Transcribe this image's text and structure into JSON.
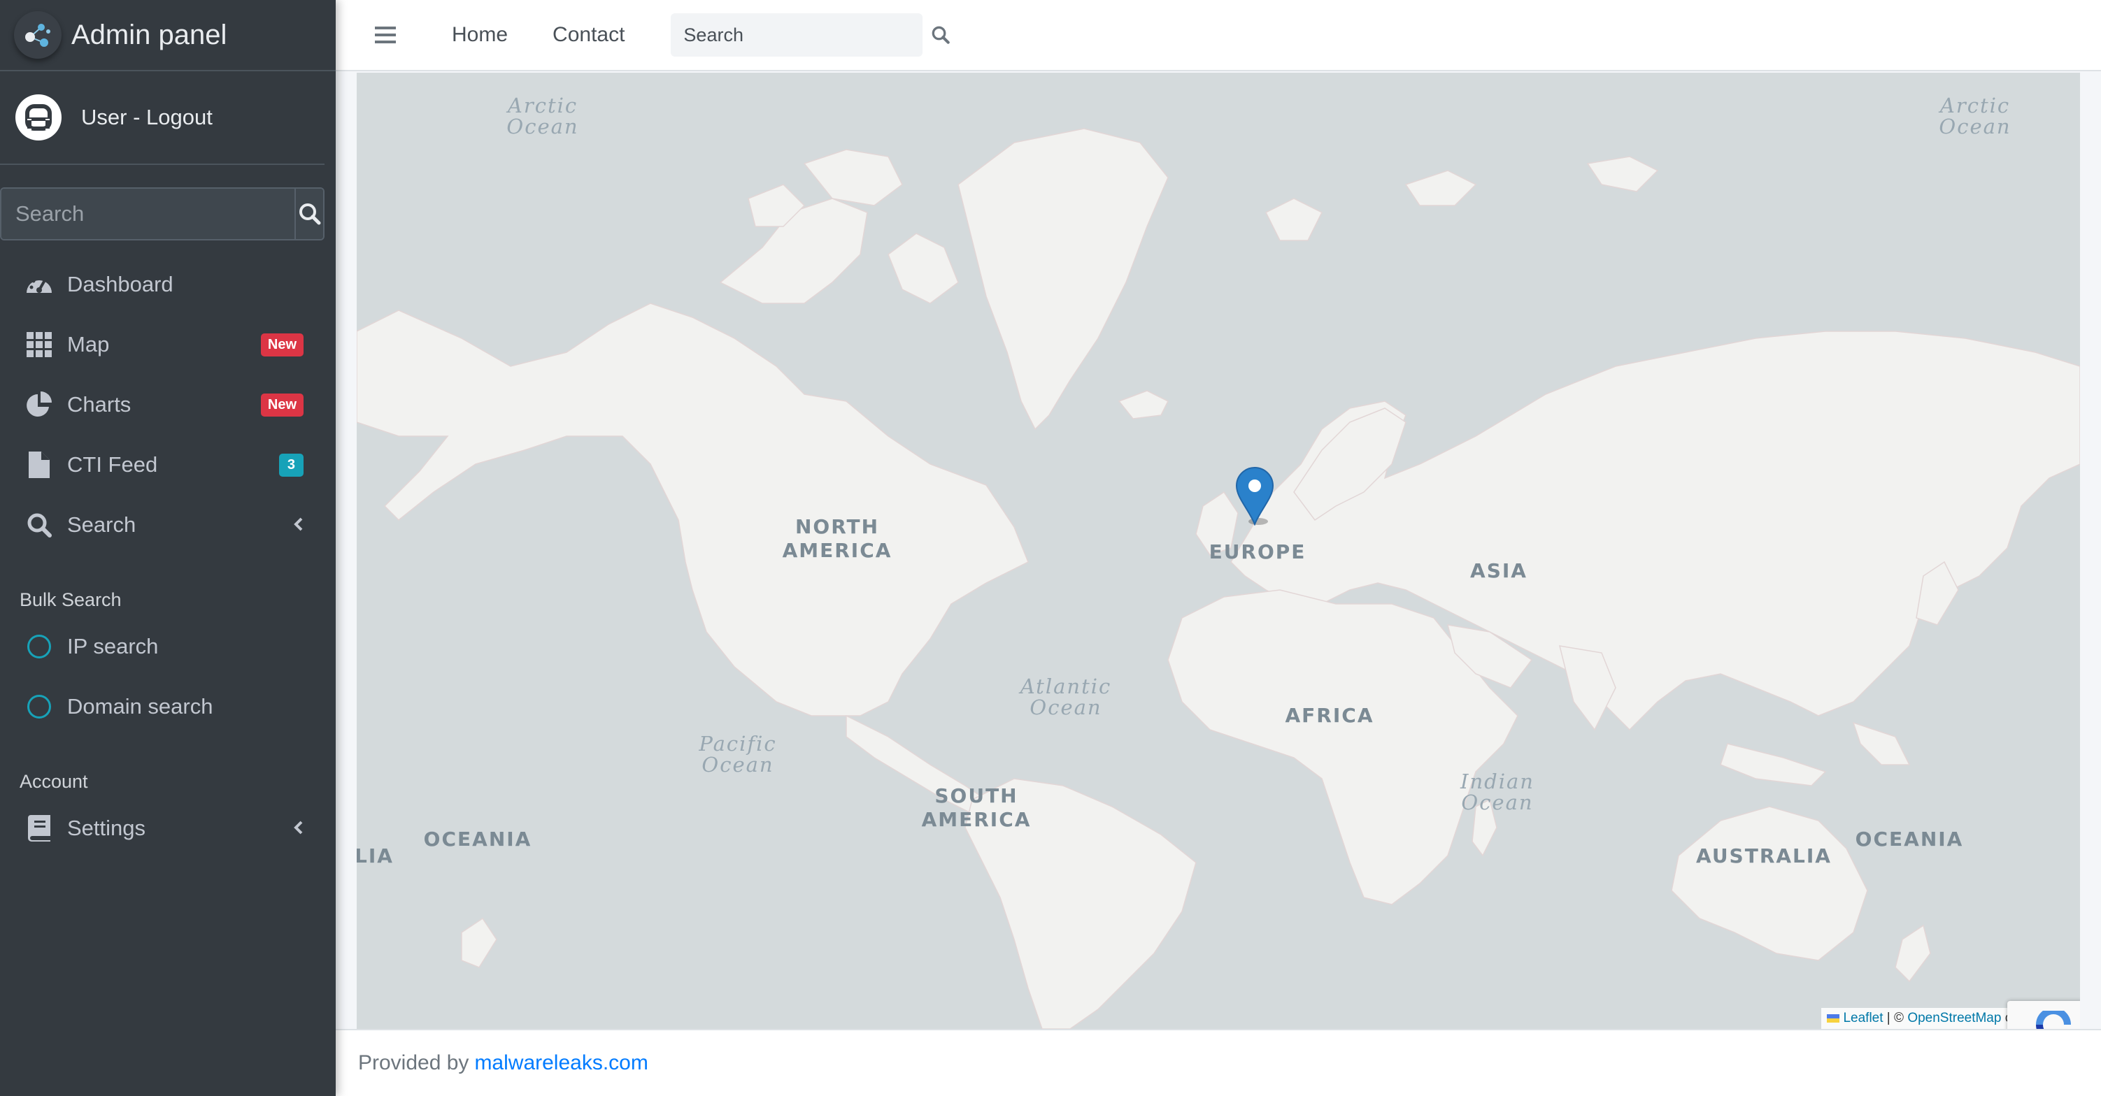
{
  "brand": {
    "title": "Admin panel"
  },
  "user": {
    "link_text": "User - Logout"
  },
  "sidebar": {
    "search_placeholder": "Search",
    "items": [
      {
        "label": "Dashboard",
        "icon": "tachometer-icon"
      },
      {
        "label": "Map",
        "icon": "grid-icon",
        "badge": "New"
      },
      {
        "label": "Charts",
        "icon": "pie-chart-icon",
        "badge": "New"
      },
      {
        "label": "CTI Feed",
        "icon": "file-icon",
        "badge": "3"
      },
      {
        "label": "Search",
        "icon": "search-icon"
      }
    ],
    "bulk_header": "Bulk Search",
    "bulk_items": [
      {
        "label": "IP search",
        "icon": "circle-icon"
      },
      {
        "label": "Domain search",
        "icon": "circle-icon"
      }
    ],
    "account_header": "Account",
    "account_items": [
      {
        "label": "Settings",
        "icon": "book-icon"
      }
    ]
  },
  "topbar": {
    "links": [
      "Home",
      "Contact"
    ],
    "search_placeholder": "Search"
  },
  "map": {
    "continent_labels": [
      "NORTH\nAMERICA",
      "EUROPE",
      "ASIA",
      "AFRICA",
      "SOUTH\nAMERICA",
      "OCEANIA",
      "AUSTRALIA",
      "OCEANIA",
      "LIA"
    ],
    "ocean_labels": [
      "Arctic\nOcean",
      "Arctic\nOcean",
      "Atlantic\nOcean",
      "Pacific\nOcean",
      "Indian\nOcean"
    ],
    "marker": {
      "location": "Germany / Netherlands (Western Europe)"
    },
    "attribution": {
      "leaflet": "Leaflet",
      "separator": " | © ",
      "osm": "OpenStreetMap",
      "suffix": " contributors"
    },
    "colors": {
      "water": "#d4dadc",
      "land": "#f2f2f0",
      "marker": "#2a81cb"
    }
  },
  "footer": {
    "prefix": "Provided by",
    "link": "malwareleaks.com"
  }
}
